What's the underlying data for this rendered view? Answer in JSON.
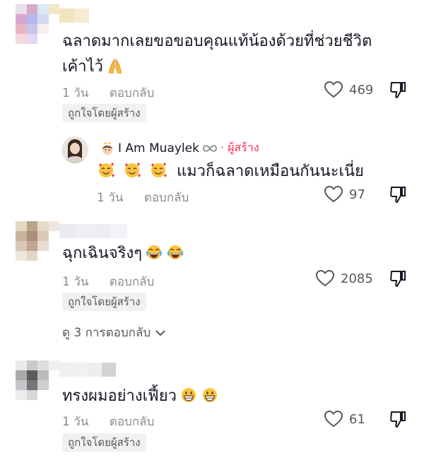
{
  "comments": [
    {
      "text_line1": "ฉลาดมากเลยขอขอบคุณแท้น้องด้วยที่ช่วยชีวิต",
      "text_line2": "เค้าไว้",
      "time": "1 วัน",
      "reply_label": "ตอบกลับ",
      "likes": "469",
      "liked_by_creator": "ถูกใจโดยผู้สร้าง",
      "emoji": [
        "folded-hands-icon"
      ]
    },
    {
      "text": "ฉุกเฉินจริงๆ",
      "time": "1 วัน",
      "reply_label": "ตอบกลับ",
      "likes": "2085",
      "liked_by_creator": "ถูกใจโดยผู้สร้าง",
      "view_replies": "ดู 3 การตอบกลับ",
      "emoji": [
        "tears-of-joy-icon",
        "tears-of-joy-icon"
      ]
    },
    {
      "text": "ทรงผมอย่างเฟี้ยว",
      "time": "1 วัน",
      "reply_label": "ตอบกลับ",
      "likes": "61",
      "liked_by_creator": "ถูกใจโดยผู้สร้าง",
      "emoji": [
        "grinning-face-icon",
        "grinning-face-icon"
      ]
    }
  ],
  "creator_reply": {
    "username": "I Am Muaylek",
    "creator_label": "· ผู้สร้าง",
    "text": "แมวก็ฉลาดเหมือนกันนะเนี่ย",
    "time": "1 วัน",
    "reply_label": "ตอบกลับ",
    "likes": "97",
    "emoji": [
      "smiling-face-with-hearts-icon",
      "smiling-face-with-hearts-icon",
      "smiling-face-with-hearts-icon"
    ]
  },
  "colors": {
    "creator_red": "#fe2c55",
    "meta_grey": "#8a8b91",
    "badge_bg": "#f1f1f2"
  }
}
